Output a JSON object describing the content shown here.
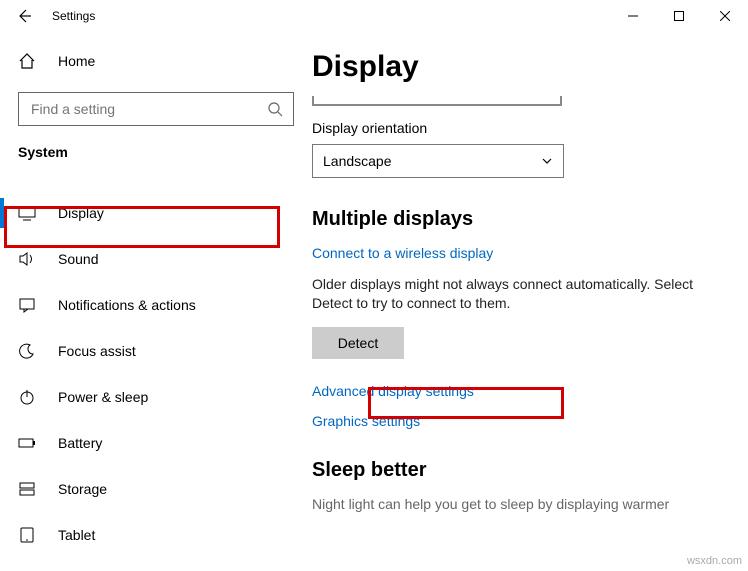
{
  "window": {
    "title": "Settings",
    "watermark": "wsxdn.com"
  },
  "sidebar": {
    "home": "Home",
    "search_placeholder": "Find a setting",
    "section": "System",
    "items": [
      {
        "label": "Display"
      },
      {
        "label": "Sound"
      },
      {
        "label": "Notifications & actions"
      },
      {
        "label": "Focus assist"
      },
      {
        "label": "Power & sleep"
      },
      {
        "label": "Battery"
      },
      {
        "label": "Storage"
      },
      {
        "label": "Tablet"
      }
    ]
  },
  "main": {
    "title": "Display",
    "orientation_label": "Display orientation",
    "orientation_value": "Landscape",
    "multiple_title": "Multiple displays",
    "wireless_link": "Connect to a wireless display",
    "older_text": "Older displays might not always connect automatically. Select Detect to try to connect to them.",
    "detect_btn": "Detect",
    "advanced_link": "Advanced display settings",
    "graphics_link": "Graphics settings",
    "sleep_title": "Sleep better",
    "sleep_desc": "Night light can help you get to sleep by displaying warmer"
  }
}
